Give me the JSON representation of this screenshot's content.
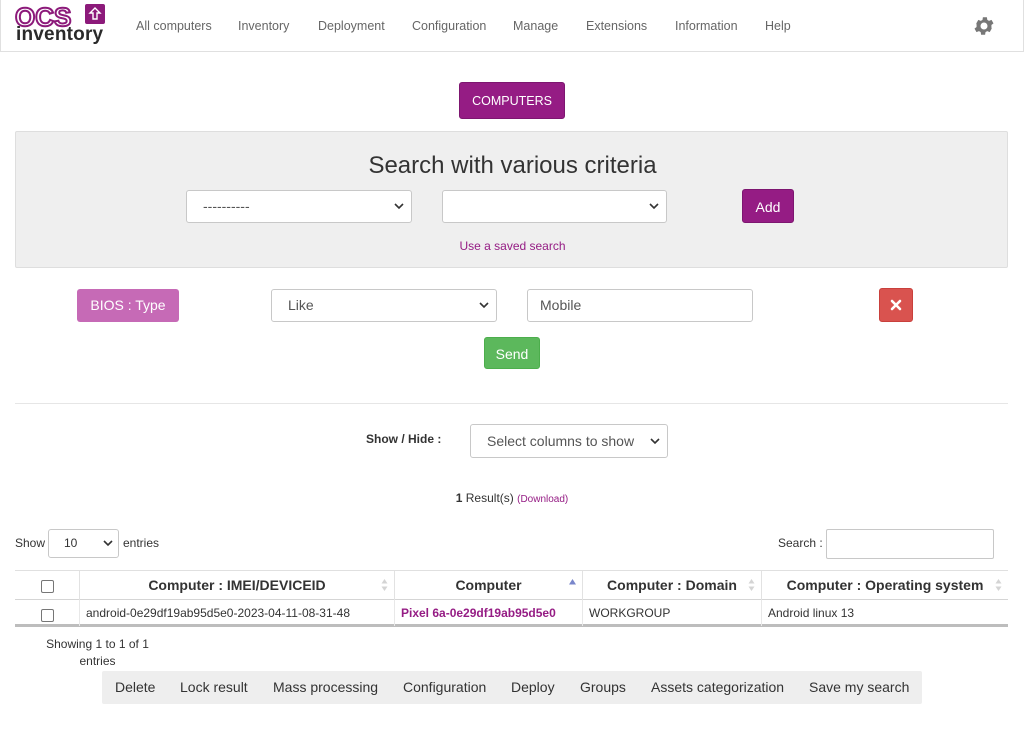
{
  "brand": {
    "logo_top": "OCS",
    "logo_bottom": "inventory",
    "color": "#951c84"
  },
  "nav": {
    "items": [
      "All computers",
      "Inventory",
      "Deployment",
      "Configuration",
      "Manage",
      "Extensions",
      "Information",
      "Help"
    ],
    "settings_icon": "gear-icon"
  },
  "page": {
    "computers_button": "COMPUTERS"
  },
  "search": {
    "title": "Search with various criteria",
    "field_select_value": "----------",
    "operator_select_value": "",
    "add_button": "Add",
    "saved_search_link": "Use a saved search"
  },
  "criterion": {
    "field": "BIOS : Type",
    "operator": "Like",
    "value": "Mobile",
    "remove_icon": "close-icon",
    "send_button": "Send"
  },
  "columns": {
    "label": "Show / Hide :",
    "select_placeholder": "Select columns to show"
  },
  "results": {
    "count": "1",
    "label": "Result(s)",
    "download": "(Download)"
  },
  "table_controls": {
    "show_label": "Show",
    "page_length": "10",
    "entries_label": "entries",
    "search_label": "Search :",
    "search_value": ""
  },
  "table": {
    "headers": [
      "Computer : IMEI/DEVICEID",
      "Computer",
      "Computer : Domain",
      "Computer : Operating system"
    ],
    "rows": [
      {
        "deviceid": "android-0e29df19ab95d5e0-2023-04-11-08-31-48",
        "computer": "Pixel 6a-0e29df19ab95d5e0",
        "domain": "WORKGROUP",
        "os": "Android linux 13"
      }
    ],
    "info": "Showing 1 to 1 of 1 entries"
  },
  "actions": [
    "Delete",
    "Lock result",
    "Mass processing",
    "Configuration",
    "Deploy",
    "Groups",
    "Assets categorization",
    "Save my search"
  ]
}
